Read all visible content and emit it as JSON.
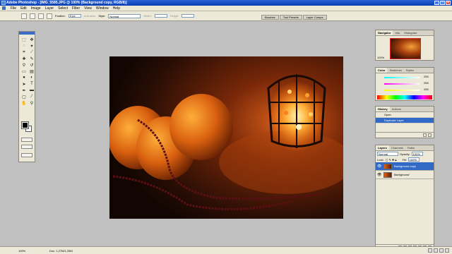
{
  "window": {
    "title": "Adobe Photoshop - [IMG_5585.JPG @ 100% (Background copy, RGB/8)]"
  },
  "menus": [
    "File",
    "Edit",
    "Image",
    "Layer",
    "Select",
    "Filter",
    "View",
    "Window",
    "Help"
  ],
  "options": {
    "feather_label": "Feather:",
    "feather_value": "0 px",
    "antialias_label": "Anti-alias",
    "style_label": "Style:",
    "style_value": "Normal",
    "width_label": "Width:",
    "height_label": "Height:"
  },
  "palette_well": [
    "Brushes",
    "Tool Presets",
    "Layer Comps"
  ],
  "navigator": {
    "tabs": [
      "Navigator",
      "Info",
      "Histogram"
    ],
    "zoom": "100%"
  },
  "color": {
    "tabs": [
      "Color",
      "Swatches",
      "Styles"
    ],
    "r": "255",
    "g": "255",
    "b": "255"
  },
  "history": {
    "tabs": [
      "History",
      "Actions"
    ],
    "items": [
      "Open",
      "Duplicate Layer"
    ]
  },
  "layers": {
    "tabs": [
      "Layers",
      "Channels",
      "Paths"
    ],
    "mode": "Normal",
    "opacity_label": "Opacity:",
    "opacity": "100%",
    "lock_label": "Lock:",
    "fill_label": "Fill:",
    "fill": "100%",
    "items": [
      "Background copy",
      "Background"
    ]
  },
  "status": {
    "zoom": "100%",
    "doc": "Doc: 1,27M/1,33M"
  },
  "colors": {
    "accent": "#3169c6",
    "titlebar": "#0a3fb4",
    "workspace": "#c0c0c0"
  }
}
